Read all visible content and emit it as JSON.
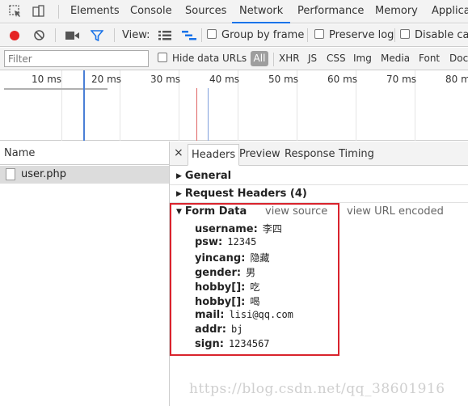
{
  "tabs": [
    "Elements",
    "Console",
    "Sources",
    "Network",
    "Performance",
    "Memory",
    "Applicat"
  ],
  "toolbar": {
    "view_label": "View:",
    "group_by_frame": "Group by frame",
    "preserve_log": "Preserve log",
    "disable_cache": "Disable cach"
  },
  "filterbar": {
    "placeholder": "Filter",
    "hide_data_urls": "Hide data URLs",
    "all": "All",
    "types": [
      "XHR",
      "JS",
      "CSS",
      "Img",
      "Media",
      "Font",
      "Doc"
    ]
  },
  "timeline": {
    "ticks": [
      "10 ms",
      "20 ms",
      "30 ms",
      "40 ms",
      "50 ms",
      "60 ms",
      "70 ms",
      "80 m"
    ]
  },
  "requests": {
    "header": "Name",
    "items": [
      "user.php"
    ]
  },
  "details": {
    "close": "×",
    "tabs": [
      "Headers",
      "Preview",
      "Response",
      "Timing"
    ],
    "general": "General",
    "request_headers": "Request Headers (4)",
    "form_data": "Form Data",
    "view_source": "view source",
    "view_url_encoded": "view URL encoded",
    "fields": [
      {
        "key": "username:",
        "value": "李四"
      },
      {
        "key": "psw:",
        "value": "12345"
      },
      {
        "key": "yincang:",
        "value": "隐藏"
      },
      {
        "key": "gender:",
        "value": "男"
      },
      {
        "key": "hobby[]:",
        "value": "吃"
      },
      {
        "key": "hobby[]:",
        "value": "喝"
      },
      {
        "key": "mail:",
        "value": "lisi@qq.com"
      },
      {
        "key": "addr:",
        "value": "bj"
      },
      {
        "key": "sign:",
        "value": "1234567"
      }
    ]
  },
  "watermark": "https://blog.csdn.net/qq_38601916",
  "colors": {
    "record": "#e52424",
    "accent": "#1a73e8",
    "highlight_box": "#d9232d"
  }
}
